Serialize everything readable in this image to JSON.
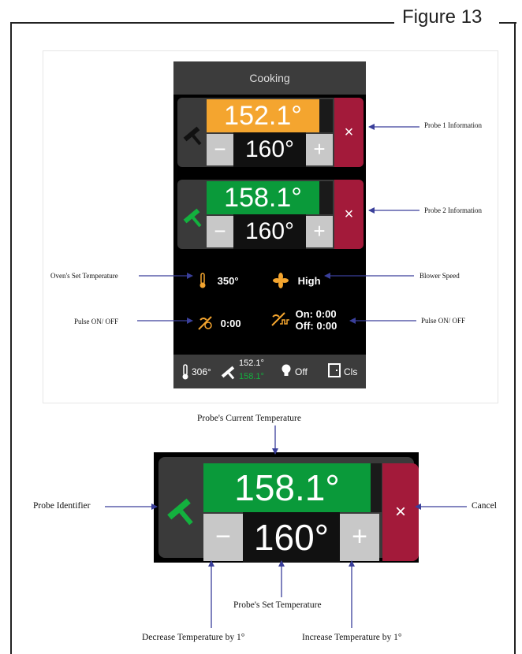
{
  "figure": {
    "label": "Figure 13"
  },
  "phone": {
    "header_title": "Cooking",
    "probe1": {
      "current": "152.1°",
      "set": "160°",
      "minus": "−",
      "plus": "+",
      "cancel": "×",
      "color": "#f4a52f",
      "icon_color": "#111111"
    },
    "probe2": {
      "current": "158.1°",
      "set": "160°",
      "minus": "−",
      "plus": "+",
      "cancel": "×",
      "color": "#0a9a3a",
      "icon_color": "#13b13e"
    },
    "oven_set_temp": "350°",
    "blower_speed": "High",
    "pulse_left": "0:00",
    "pulse_on": "On: 0:00",
    "pulse_off": "Off: 0:00",
    "status": {
      "oven_temp": "306°",
      "probe1_temp": "152.1°",
      "probe2_temp": "158.1°",
      "light": "Off",
      "door": "Cls"
    }
  },
  "annotations": {
    "probe1_info": "Probe 1 Information",
    "probe2_info": "Probe 2 Information",
    "oven_set_temperature": "Oven's Set Temperature",
    "blower_speed": "Blower Speed",
    "pulse_left": "Pulse ON/ OFF",
    "pulse_right": "Pulse ON/ OFF",
    "probe_current_temp": "Probe's Current Temperature",
    "probe_identifier": "Probe Identifier",
    "cancel": "Cancel",
    "probe_set_temp": "Probe's Set Temperature",
    "decrease": "Decrease Temperature by 1°",
    "increase": "Increase Temperature by 1°"
  },
  "detail": {
    "current": "158.1°",
    "set": "160°",
    "minus": "−",
    "plus": "+",
    "cancel": "×"
  },
  "colors": {
    "accent_arrow": "#3a3f9a",
    "cancel_red": "#a31a3a",
    "orange": "#f4a52f",
    "green": "#0a9a3a"
  }
}
